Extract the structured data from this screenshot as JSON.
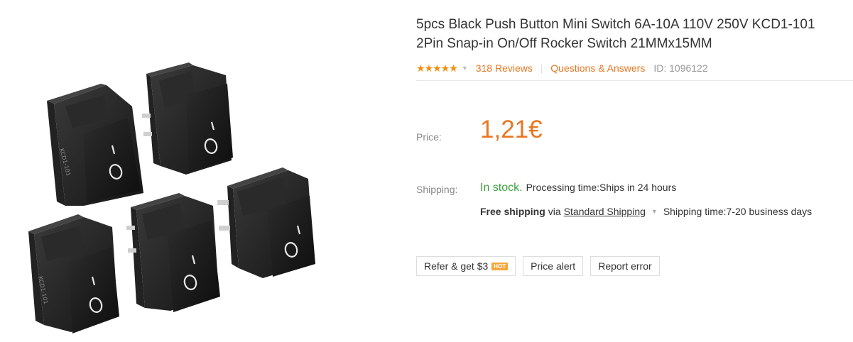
{
  "product": {
    "title_line1": "5pcs Black Push Button Mini Switch 6A-10A 110V 250V KCD1-101",
    "title_line2": "2Pin Snap-in On/Off Rocker Switch 21MMx15MM",
    "rating_stars": 5,
    "reviews": "318 Reviews",
    "qa": "Questions & Answers",
    "id": "ID: 1096122"
  },
  "price": {
    "label": "Price:",
    "value": "1,21€",
    "color": "#e87722"
  },
  "shipping": {
    "label": "Shipping:",
    "stock": "In stock.",
    "processing": "Processing time:Ships in 24 hours",
    "free": "Free shipping",
    "via": "via",
    "method": "Standard Shipping",
    "time": "Shipping time:7-20 business days"
  },
  "buttons": {
    "refer": "Refer & get $3",
    "hot": "HOT",
    "price_alert": "Price alert",
    "report": "Report error"
  },
  "switch_marks": {
    "on": "I",
    "off": "O"
  },
  "icons": [
    "star-icon",
    "chevron-down-icon"
  ]
}
